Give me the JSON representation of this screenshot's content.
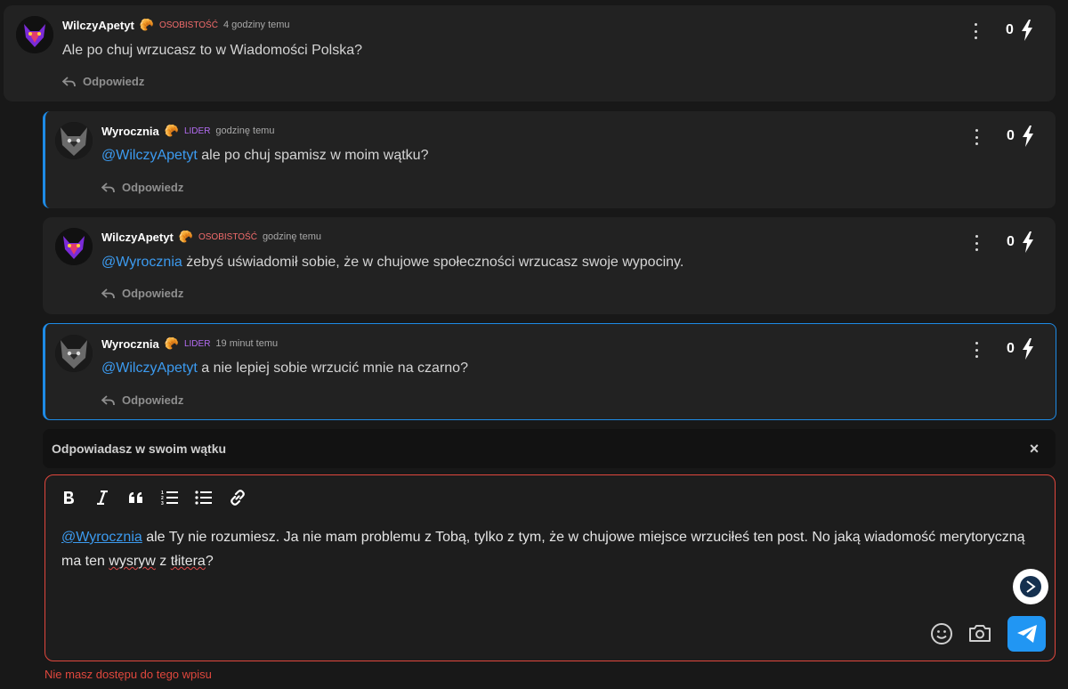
{
  "comments": [
    {
      "username": "WilczyApetyt",
      "badge": "🥐",
      "role": "OSOBISTOŚĆ",
      "time": "4 godziny temu",
      "mention": "",
      "text": "Ale po chuj wrzucasz to w Wiadomości Polska?",
      "reply_label": "Odpowiedz",
      "votes": "0"
    },
    {
      "username": "Wyrocznia",
      "badge": "🥐",
      "role": "LIDER",
      "time": "godzinę temu",
      "mention": "@WilczyApetyt",
      "text": " ale po chuj spamisz w moim wątku?",
      "reply_label": "Odpowiedz",
      "votes": "0"
    },
    {
      "username": "WilczyApetyt",
      "badge": "🥐",
      "role": "OSOBISTOŚĆ",
      "time": "godzinę temu",
      "mention": "@Wyrocznia",
      "text": " żebyś uświadomił sobie, że w chujowe społeczności wrzucasz swoje wypociny.",
      "reply_label": "Odpowiedz",
      "votes": "0"
    },
    {
      "username": "Wyrocznia",
      "badge": "🥐",
      "role": "LIDER",
      "time": "19 minut temu",
      "mention": "@WilczyApetyt",
      "text": " a nie lepiej sobie wrzucić mnie na czarno?",
      "reply_label": "Odpowiedz",
      "votes": "0"
    }
  ],
  "reply_context": {
    "label": "Odpowiadasz w swoim wątku",
    "close": "×"
  },
  "editor": {
    "toolbar": [
      "bold",
      "italic",
      "quote",
      "ordered-list",
      "bullet-list",
      "link"
    ],
    "mention": "@Wyrocznia",
    "text_part1": " ale Ty nie rozumiesz. Ja nie mam problemu z Tobą, tylko z tym, że w chujowe miejsce wrzuciłeś ten post. No jaką wiadomość merytoryczną ma ten ",
    "misspelled1": "wysryw",
    "text_part2": " z ",
    "misspelled2": "tłitera",
    "text_part3": "?"
  },
  "error_note": "Nie masz dostępu do tego wpisu",
  "colors": {
    "accent": "#2196f3",
    "error": "#e0473d",
    "mention": "#3c9bf0",
    "role_osobistosc": "#f26c6c",
    "role_lider": "#b36cf2"
  }
}
